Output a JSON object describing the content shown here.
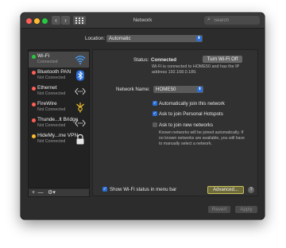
{
  "window": {
    "title": "Network"
  },
  "search": {
    "placeholder": "Search"
  },
  "location": {
    "label": "Location:",
    "value": "Automatic"
  },
  "sidebar": {
    "services": [
      {
        "name": "Wi-Fi",
        "status": "Connected",
        "dot_color": "#28c840",
        "icon": "wifi-icon"
      },
      {
        "name": "Bluetooth PAN",
        "status": "Not Connected",
        "dot_color": "#ff5f57",
        "icon": "bluetooth-icon"
      },
      {
        "name": "Ethernet",
        "status": "Not Connected",
        "dot_color": "#ff5f57",
        "icon": "ethernet-icon"
      },
      {
        "name": "FireWire",
        "status": "Not Connected",
        "dot_color": "#ff5f57",
        "icon": "firewire-icon"
      },
      {
        "name": "Thunde...lt Bridge",
        "status": "Not Connected",
        "dot_color": "#ff5f57",
        "icon": "thunderbolt-bridge-icon"
      },
      {
        "name": "HideMy...me VPN",
        "status": "Not Connected",
        "dot_color": "#febc2e",
        "icon": "vpn-lock-icon"
      }
    ],
    "toolbar": {
      "add": "+",
      "remove": "—",
      "gear": "⚙▾"
    }
  },
  "detail": {
    "status_label": "Status:",
    "status_value": "Connected",
    "turn_off_label": "Turn Wi-Fi Off",
    "status_description": "Wi-Fi is connected to HOME50 and has the IP address 192.168.0.189.",
    "network_name_label": "Network Name:",
    "network_name_value": "HOME50",
    "auto_join_label": "Automatically join this network",
    "auto_join_checked": true,
    "ask_hotspots_label": "Ask to join Personal Hotspots",
    "ask_hotspots_checked": true,
    "ask_new_label": "Ask to join new networks",
    "ask_new_checked": false,
    "known_networks_description": "Known networks will be joined automatically. If no known networks are available, you will have to manually select a network."
  },
  "bottom": {
    "show_status_label": "Show Wi-Fi status in menu bar",
    "show_status_checked": true,
    "advanced_label": "Advanced...",
    "help_label": "?",
    "revert_label": "Revert",
    "apply_label": "Apply"
  },
  "colors": {
    "accent": "#2b6fd9",
    "window_bg": "#2c2c2c",
    "advanced_border": "#c8c25a"
  }
}
